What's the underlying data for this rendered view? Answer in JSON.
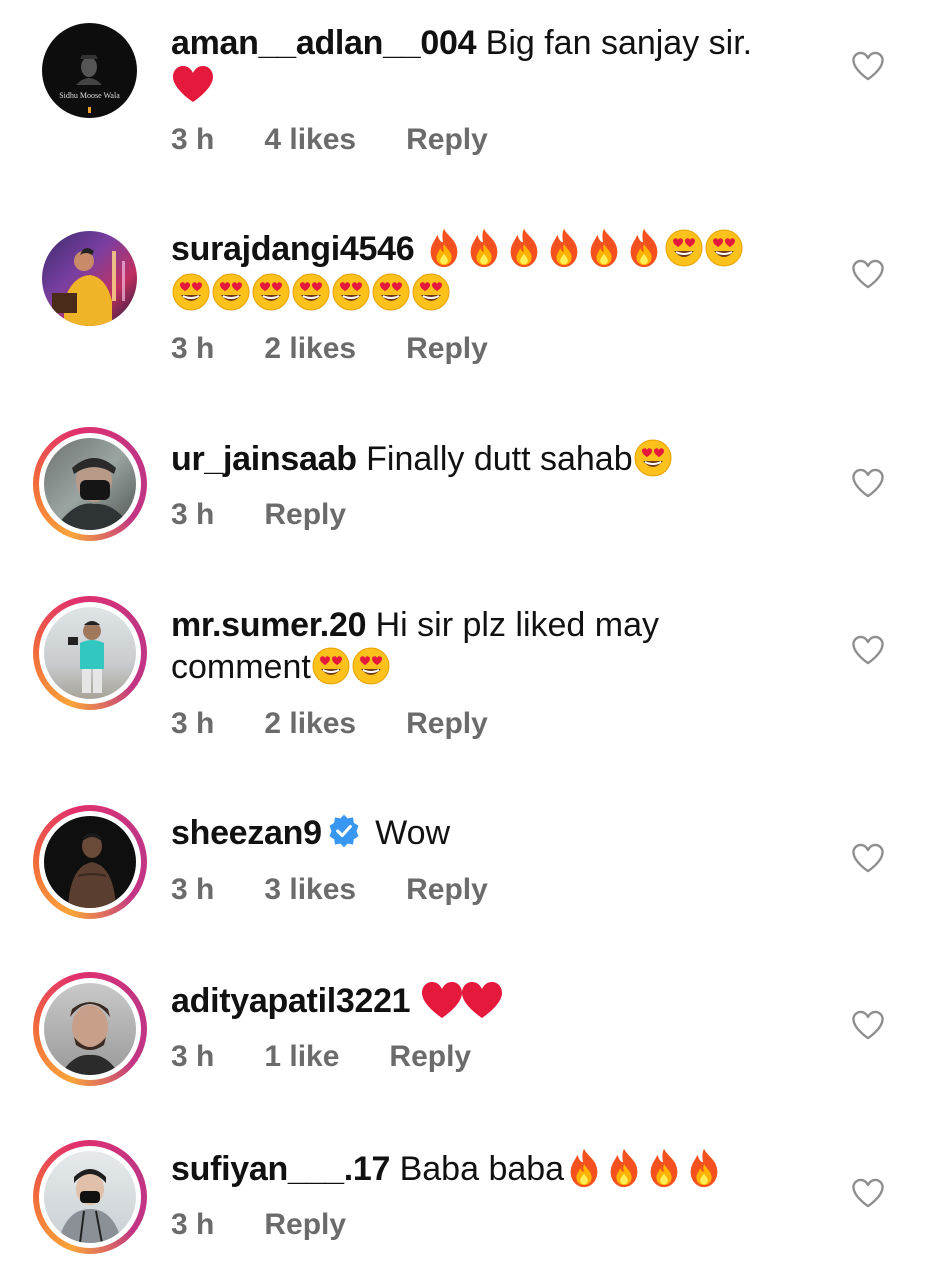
{
  "comments": [
    {
      "username": "aman__adlan__004",
      "text": "Big fan sanjay sir.",
      "emoji_line2": [
        "red-heart"
      ],
      "time": "3 h",
      "likes": "4 likes",
      "reply": "Reply",
      "avatar_caption": "Sidhu Moose Wala",
      "ring": false
    },
    {
      "username": "surajdangi4546",
      "text": "",
      "emojis": [
        "fire",
        "fire",
        "fire",
        "fire",
        "fire",
        "fire",
        "heart-eyes",
        "heart-eyes"
      ],
      "emoji_line2": [
        "heart-eyes",
        "heart-eyes",
        "heart-eyes",
        "heart-eyes",
        "heart-eyes",
        "heart-eyes",
        "heart-eyes"
      ],
      "time": "3 h",
      "likes": "2 likes",
      "reply": "Reply",
      "ring": false
    },
    {
      "username": "ur_jainsaab",
      "text": "Finally dutt sahab",
      "emojis": [
        "heart-eyes"
      ],
      "time": "3 h",
      "likes": "",
      "reply": "Reply",
      "ring": true
    },
    {
      "username": "mr.sumer.20",
      "text": "Hi sir plz liked may",
      "text2": "comment",
      "emoji_line2": [
        "heart-eyes",
        "heart-eyes"
      ],
      "time": "3 h",
      "likes": "2 likes",
      "reply": "Reply",
      "ring": true
    },
    {
      "username": "sheezan9",
      "verified": true,
      "text": "Wow",
      "time": "3 h",
      "likes": "3 likes",
      "reply": "Reply",
      "ring": true
    },
    {
      "username": "adityapatil3221",
      "text": "",
      "emojis": [
        "red-heart",
        "red-heart"
      ],
      "time": "3 h",
      "likes": "1 like",
      "reply": "Reply",
      "ring": true
    },
    {
      "username": "sufiyan___.17",
      "text": "Baba baba",
      "emojis": [
        "fire",
        "fire",
        "fire",
        "fire"
      ],
      "time": "3 h",
      "likes": "",
      "reply": "Reply",
      "ring": true
    }
  ],
  "colors": {
    "username": "#111111",
    "meta": "#6b6b6b",
    "verified": "#3897f0",
    "heart": "#8e8e8e"
  },
  "icons": {
    "like": "heart-outline-icon",
    "verified": "verified-badge-icon"
  }
}
